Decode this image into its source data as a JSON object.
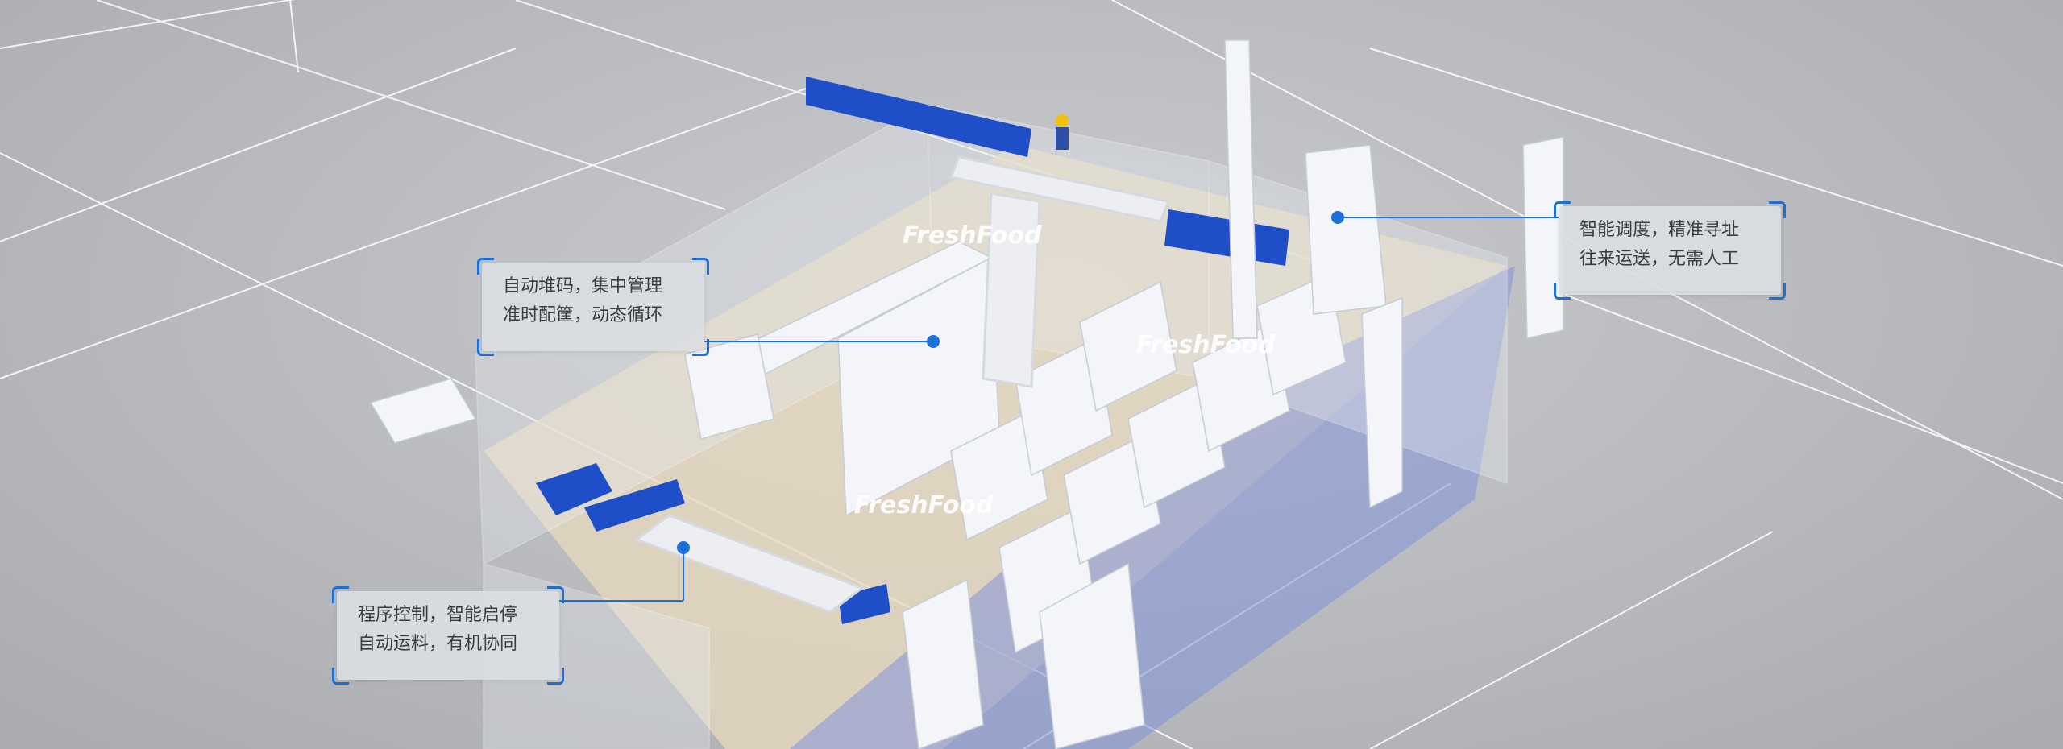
{
  "brand": {
    "watermark": "FreshFood",
    "accent_color": "#1c6fd6",
    "conveyor_color": "#1e4fc9"
  },
  "callouts": [
    {
      "id": "stacking",
      "lines": [
        "自动堆码，集中管理",
        "准时配筐，动态循环"
      ]
    },
    {
      "id": "dispatch",
      "lines": [
        "智能调度，精准寻址",
        "往来运送，无需人工"
      ]
    },
    {
      "id": "control",
      "lines": [
        "程序控制，智能启停",
        "自动运料，有机协同"
      ]
    }
  ]
}
